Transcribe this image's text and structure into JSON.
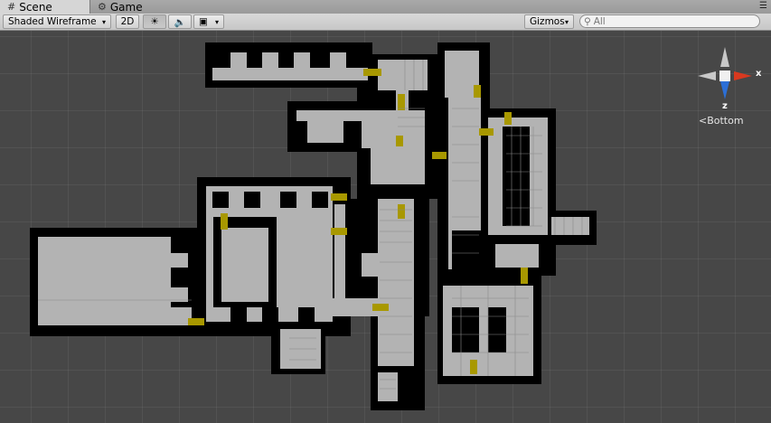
{
  "tabs": [
    {
      "label": "Scene",
      "icon": "scene-grid-icon",
      "active": true
    },
    {
      "label": "Game",
      "icon": "game-controller-icon",
      "active": false
    }
  ],
  "toolbar": {
    "draw_mode": "Shaded Wireframe",
    "two_d": "2D",
    "lighting_icon": "sun-icon",
    "audio_icon": "speaker-icon",
    "effects_icon": "image-icon",
    "gizmos": "Gizmos",
    "search_placeholder": "All"
  },
  "gizmo": {
    "x_label": "x",
    "z_label": "z",
    "view_label": "Bottom",
    "colors": {
      "x": "#d8391f",
      "y": "#b7e34a",
      "z": "#2c6fd6",
      "neutral": "#c8c8c8"
    }
  },
  "colors": {
    "scene_bg": "#474747",
    "wall": "#000000",
    "floor": "#b3b3b3",
    "door": "#a89800"
  }
}
